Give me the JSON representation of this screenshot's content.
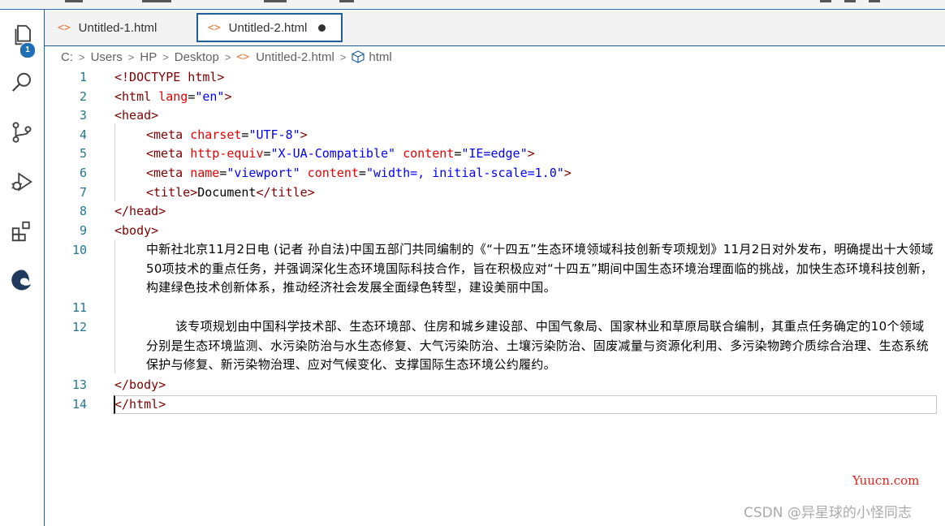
{
  "tabs": [
    {
      "label": "Untitled-1.html",
      "icon": "html-file-icon"
    },
    {
      "label": "Untitled-2.html",
      "icon": "html-file-icon",
      "active": true,
      "modified": true
    }
  ],
  "tab_icon_glyph": "<>",
  "breadcrumb": [
    "C:",
    "Users",
    "HP",
    "Desktop",
    "Untitled-2.html",
    "html"
  ],
  "activity": {
    "explorer_badge": "1"
  },
  "lines": [
    {
      "n": "1"
    },
    {
      "n": "2"
    },
    {
      "n": "3"
    },
    {
      "n": "4"
    },
    {
      "n": "5"
    },
    {
      "n": "6"
    },
    {
      "n": "7"
    },
    {
      "n": "8"
    },
    {
      "n": "9"
    },
    {
      "n": "10"
    },
    {
      "n": "11"
    },
    {
      "n": "12"
    },
    {
      "n": "13"
    },
    {
      "n": "14"
    }
  ],
  "code": {
    "l1": "<!DOCTYPE html>",
    "l2a": "<html ",
    "l2b": "lang",
    "l2c": "=",
    "l2d": "\"en\"",
    "l2e": ">",
    "l3": "<head>",
    "l4a": "<meta ",
    "l4b": "charset",
    "l4c": "=",
    "l4d": "\"UTF-8\"",
    "l4e": ">",
    "l5a": "<meta ",
    "l5b": "http-equiv",
    "l5c": "=",
    "l5d": "\"X-UA-Compatible\"",
    "l5f": " content",
    "l5g": "=",
    "l5h": "\"IE=edge\"",
    "l5e": ">",
    "l6a": "<meta ",
    "l6b": "name",
    "l6c": "=",
    "l6d": "\"viewport\"",
    "l6f": " content",
    "l6g": "=",
    "l6h": "\"width=, initial-scale=1.0\"",
    "l6e": ">",
    "l7a": "<title>",
    "l7b": "Document",
    "l7c": "</title>",
    "l8": "</head>",
    "l9": "<body>",
    "l10": "中新社北京11月2日电 (记者 孙自法)中国五部门共同编制的《“十四五”生态环境领域科技创新专项规划》11月2日对外发布，明确提出十大领域50项技术的重点任务，并强调深化生态环境国际科技合作，旨在积极应对“十四五”期间中国生态环境治理面临的挑战，加快生态环境科技创新，构建绿色技术创新体系，推动经济社会发展全面绿色转型，建设美丽中国。",
    "l12": "该专项规划由中国科学技术部、生态环境部、住房和城乡建设部、中国气象局、国家林业和草原局联合编制，其重点任务确定的10个领域分别是生态环境监测、水污染防治与水生态修复、大气污染防治、土壤污染防治、固废减量与资源化利用、多污染物跨介质综合治理、生态系统保护与修复、新污染物治理、应对气候变化、支撑国际生态环境公约履约。",
    "l13": "</body>",
    "l14": "</html>"
  },
  "watermark": {
    "site": "Yuucn.com",
    "csdn": "CSDN @异星球的小怪同志"
  },
  "colors": {
    "accent": "#1f5e9c",
    "tag": "#800000",
    "attr": "#e50000",
    "string": "#0000ff",
    "line_number": "#237893",
    "html_icon": "#e37933"
  }
}
